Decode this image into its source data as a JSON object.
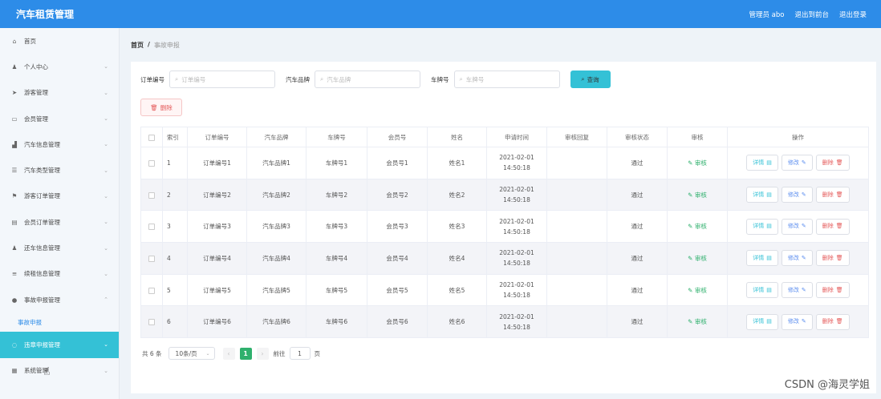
{
  "header": {
    "title": "汽车租赁管理",
    "admin": "管理员 abo",
    "front": "退出到前台",
    "logout": "退出登录"
  },
  "sidebar": {
    "items": [
      {
        "label": "首页",
        "icon": "home-icon",
        "glyph": "⌂",
        "chev": ""
      },
      {
        "label": "个人中心",
        "icon": "user-icon",
        "glyph": "♟",
        "chev": "⌄"
      },
      {
        "label": "游客管理",
        "icon": "send-icon",
        "glyph": "➤",
        "chev": "⌄"
      },
      {
        "label": "会员管理",
        "icon": "card-icon",
        "glyph": "▭",
        "chev": "⌄"
      },
      {
        "label": "汽车信息管理",
        "icon": "car-icon",
        "glyph": "▟",
        "chev": "⌄"
      },
      {
        "label": "汽车类型管理",
        "icon": "list-icon",
        "glyph": "☰",
        "chev": "⌄"
      },
      {
        "label": "游客订单管理",
        "icon": "flag-icon",
        "glyph": "⚑",
        "chev": "⌄"
      },
      {
        "label": "会员订单管理",
        "icon": "doc-icon",
        "glyph": "▤",
        "chev": "⌄"
      },
      {
        "label": "还车信息管理",
        "icon": "user-icon",
        "glyph": "♟",
        "chev": "⌄"
      },
      {
        "label": "续租信息管理",
        "icon": "menu-icon",
        "glyph": "≡",
        "chev": "⌄"
      },
      {
        "label": "事故申报管理",
        "icon": "location-icon",
        "glyph": "●",
        "chev": "⌃"
      }
    ],
    "submenu": "事故申报",
    "items2": [
      {
        "label": "违章申报管理",
        "icon": "circle-icon",
        "glyph": "◌",
        "chev": "⌄"
      },
      {
        "label": "系统管理",
        "icon": "monitor-icon",
        "glyph": "▦",
        "chev": "⌄"
      }
    ]
  },
  "breadcrumb": {
    "home": "首页",
    "sep": "/",
    "current": "事故申报"
  },
  "search": {
    "order_label": "订单编号",
    "order_ph": "订单编号",
    "brand_label": "汽车品牌",
    "brand_ph": "汽车品牌",
    "plate_label": "车牌号",
    "plate_ph": "车牌号",
    "button": "查询"
  },
  "delete_button": "删除",
  "table": {
    "headers": [
      "",
      "索引",
      "订单编号",
      "汽车品牌",
      "车牌号",
      "会员号",
      "姓名",
      "申请时间",
      "审核回复",
      "审核状态",
      "审核",
      "操作"
    ],
    "rows": [
      {
        "idx": "1",
        "order": "订单编号1",
        "brand": "汽车品牌1",
        "plate": "车牌号1",
        "member": "会员号1",
        "name": "姓名1",
        "time": "2021-02-01 14:50:18",
        "reply": "",
        "status": "通过",
        "audit": "审核"
      },
      {
        "idx": "2",
        "order": "订单编号2",
        "brand": "汽车品牌2",
        "plate": "车牌号2",
        "member": "会员号2",
        "name": "姓名2",
        "time": "2021-02-01 14:50:18",
        "reply": "",
        "status": "通过",
        "audit": "审核"
      },
      {
        "idx": "3",
        "order": "订单编号3",
        "brand": "汽车品牌3",
        "plate": "车牌号3",
        "member": "会员号3",
        "name": "姓名3",
        "time": "2021-02-01 14:50:18",
        "reply": "",
        "status": "通过",
        "audit": "审核"
      },
      {
        "idx": "4",
        "order": "订单编号4",
        "brand": "汽车品牌4",
        "plate": "车牌号4",
        "member": "会员号4",
        "name": "姓名4",
        "time": "2021-02-01 14:50:18",
        "reply": "",
        "status": "通过",
        "audit": "审核"
      },
      {
        "idx": "5",
        "order": "订单编号5",
        "brand": "汽车品牌5",
        "plate": "车牌号5",
        "member": "会员号5",
        "name": "姓名5",
        "time": "2021-02-01 14:50:18",
        "reply": "",
        "status": "通过",
        "audit": "审核"
      },
      {
        "idx": "6",
        "order": "订单编号6",
        "brand": "汽车品牌6",
        "plate": "车牌号6",
        "member": "会员号6",
        "name": "姓名6",
        "time": "2021-02-01 14:50:18",
        "reply": "",
        "status": "通过",
        "audit": "审核"
      }
    ],
    "ops": {
      "detail": "详情",
      "edit": "修改",
      "delete": "删除"
    }
  },
  "pager": {
    "total": "共 6 条",
    "size": "10条/页",
    "page": "1",
    "goto": "前往",
    "goto_value": "1",
    "page_suffix": "页"
  },
  "watermark": "CSDN @海灵学姐",
  "colors": {
    "topbar": "#2d8ce8",
    "active": "#34c1d6",
    "success": "#2fb06d",
    "danger": "#e45858"
  }
}
